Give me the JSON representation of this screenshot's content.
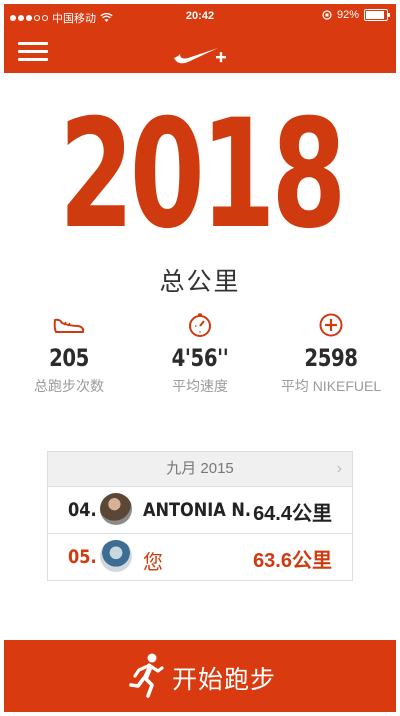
{
  "status_bar": {
    "carrier": "中国移动",
    "time": "20:42",
    "battery": "92%"
  },
  "header": {
    "menu_icon": "hamburger-icon",
    "logo_icon": "nike-plus-logo"
  },
  "summary": {
    "total": "2018",
    "unit": "总公里"
  },
  "stats": [
    {
      "icon": "shoe-icon",
      "value": "205",
      "label": "总跑步次数"
    },
    {
      "icon": "stopwatch-icon",
      "value": "4'56''",
      "label": "平均速度"
    },
    {
      "icon": "fuel-plus-icon",
      "value": "2598",
      "label": "平均 NIKEFUEL"
    }
  ],
  "leaderboard": {
    "month": "九月 2015",
    "rows": [
      {
        "rank": "04.",
        "name": "ANTONIA N.",
        "distance": "64.4公里"
      },
      {
        "rank": "05.",
        "name": "您",
        "distance": "63.6公里"
      }
    ]
  },
  "start_button": {
    "label": "开始跑步"
  },
  "colors": {
    "accent": "#d93a0f",
    "number": "#cf3a0e"
  }
}
